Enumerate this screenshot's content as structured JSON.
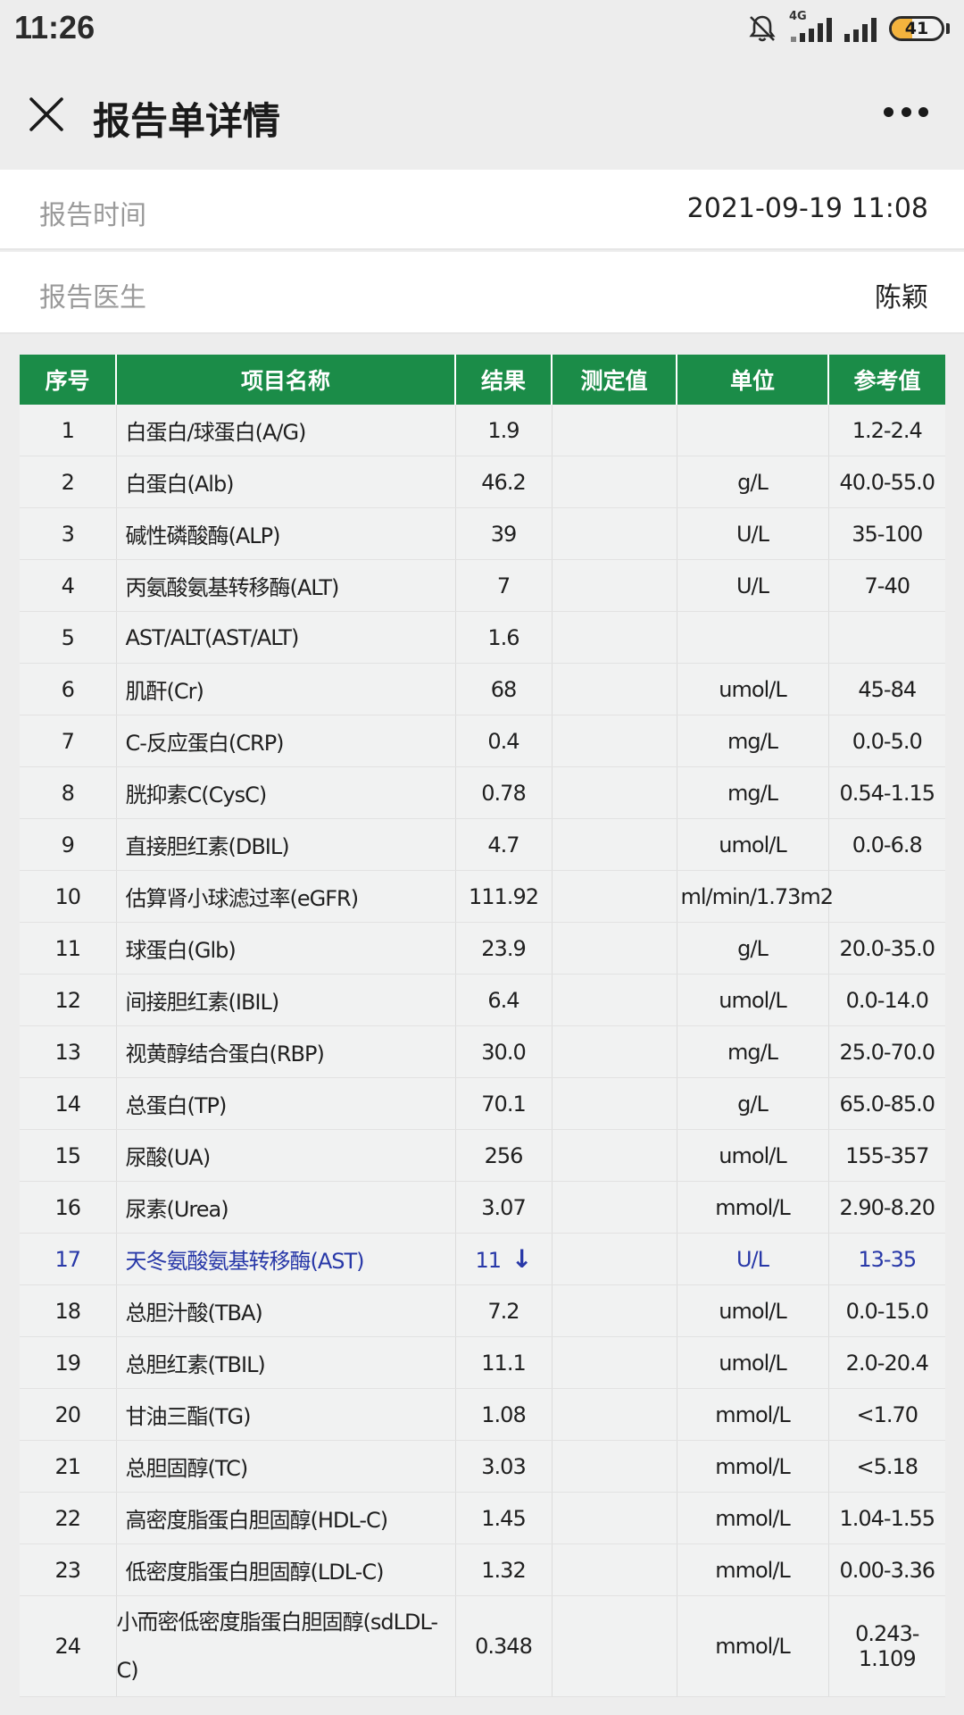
{
  "status_bar": {
    "time": "11:26",
    "network": "4G",
    "battery_level": "41",
    "battery_fraction": 0.41
  },
  "nav": {
    "title": "报告单详情"
  },
  "info": {
    "report_time_label": "报告时间",
    "report_time_value": "2021-09-19 11:08",
    "doctor_label": "报告医生",
    "doctor_value": "陈颖"
  },
  "table": {
    "headers": [
      "序号",
      "项目名称",
      "结果",
      "测定值",
      "单位",
      "参考值"
    ],
    "rows": [
      {
        "no": "1",
        "name": "白蛋白/球蛋白(A/G)",
        "result": "1.9",
        "measured": "",
        "unit": "",
        "ref": "1.2-2.4"
      },
      {
        "no": "2",
        "name": "白蛋白(Alb)",
        "result": "46.2",
        "measured": "",
        "unit": "g/L",
        "ref": "40.0-55.0"
      },
      {
        "no": "3",
        "name": "碱性磷酸酶(ALP)",
        "result": "39",
        "measured": "",
        "unit": "U/L",
        "ref": "35-100"
      },
      {
        "no": "4",
        "name": "丙氨酸氨基转移酶(ALT)",
        "result": "7",
        "measured": "",
        "unit": "U/L",
        "ref": "7-40"
      },
      {
        "no": "5",
        "name": "AST/ALT(AST/ALT)",
        "result": "1.6",
        "measured": "",
        "unit": "",
        "ref": ""
      },
      {
        "no": "6",
        "name": "肌酐(Cr)",
        "result": "68",
        "measured": "",
        "unit": "umol/L",
        "ref": "45-84"
      },
      {
        "no": "7",
        "name": "C-反应蛋白(CRP)",
        "result": "0.4",
        "measured": "",
        "unit": "mg/L",
        "ref": "0.0-5.0"
      },
      {
        "no": "8",
        "name": "胱抑素C(CysC)",
        "result": "0.78",
        "measured": "",
        "unit": "mg/L",
        "ref": "0.54-1.15"
      },
      {
        "no": "9",
        "name": "直接胆红素(DBIL)",
        "result": "4.7",
        "measured": "",
        "unit": "umol/L",
        "ref": "0.0-6.8"
      },
      {
        "no": "10",
        "name": "估算肾小球滤过率(eGFR)",
        "result": "111.92",
        "measured": "",
        "unit": "ml/min/1.73m2",
        "ref": ""
      },
      {
        "no": "11",
        "name": "球蛋白(Glb)",
        "result": "23.9",
        "measured": "",
        "unit": "g/L",
        "ref": "20.0-35.0"
      },
      {
        "no": "12",
        "name": "间接胆红素(IBIL)",
        "result": "6.4",
        "measured": "",
        "unit": "umol/L",
        "ref": "0.0-14.0"
      },
      {
        "no": "13",
        "name": "视黄醇结合蛋白(RBP)",
        "result": "30.0",
        "measured": "",
        "unit": "mg/L",
        "ref": "25.0-70.0"
      },
      {
        "no": "14",
        "name": "总蛋白(TP)",
        "result": "70.1",
        "measured": "",
        "unit": "g/L",
        "ref": "65.0-85.0"
      },
      {
        "no": "15",
        "name": "尿酸(UA)",
        "result": "256",
        "measured": "",
        "unit": "umol/L",
        "ref": "155-357"
      },
      {
        "no": "16",
        "name": "尿素(Urea)",
        "result": "3.07",
        "measured": "",
        "unit": "mmol/L",
        "ref": "2.90-8.20"
      },
      {
        "no": "17",
        "name": "天冬氨酸氨基转移酶(AST)",
        "result": "11",
        "arrow": "↓",
        "measured": "",
        "unit": "U/L",
        "ref": "13-35",
        "abnormal": true
      },
      {
        "no": "18",
        "name": "总胆汁酸(TBA)",
        "result": "7.2",
        "measured": "",
        "unit": "umol/L",
        "ref": "0.0-15.0"
      },
      {
        "no": "19",
        "name": "总胆红素(TBIL)",
        "result": "11.1",
        "measured": "",
        "unit": "umol/L",
        "ref": "2.0-20.4"
      },
      {
        "no": "20",
        "name": "甘油三酯(TG)",
        "result": "1.08",
        "measured": "",
        "unit": "mmol/L",
        "ref": "<1.70"
      },
      {
        "no": "21",
        "name": "总胆固醇(TC)",
        "result": "3.03",
        "measured": "",
        "unit": "mmol/L",
        "ref": "<5.18"
      },
      {
        "no": "22",
        "name": "高密度脂蛋白胆固醇(HDL-C)",
        "result": "1.45",
        "measured": "",
        "unit": "mmol/L",
        "ref": "1.04-1.55"
      },
      {
        "no": "23",
        "name": "低密度脂蛋白胆固醇(LDL-C)",
        "result": "1.32",
        "measured": "",
        "unit": "mmol/L",
        "ref": "0.00-3.36"
      },
      {
        "no": "24",
        "name": "小而密低密度脂蛋白胆固醇(sdLDL-C)",
        "result": "0.348",
        "measured": "",
        "unit": "mmol/L",
        "ref": "0.243-1.109",
        "tall": true
      }
    ]
  },
  "colors": {
    "header_green": "#1b8c48",
    "abnormal_blue": "#2838a8",
    "battery_fill": "#f3b33d"
  },
  "icons": {
    "close": "close-icon",
    "more": "more-icon",
    "bell": "bell-off-icon",
    "arrow_down": "arrow-down-icon"
  }
}
